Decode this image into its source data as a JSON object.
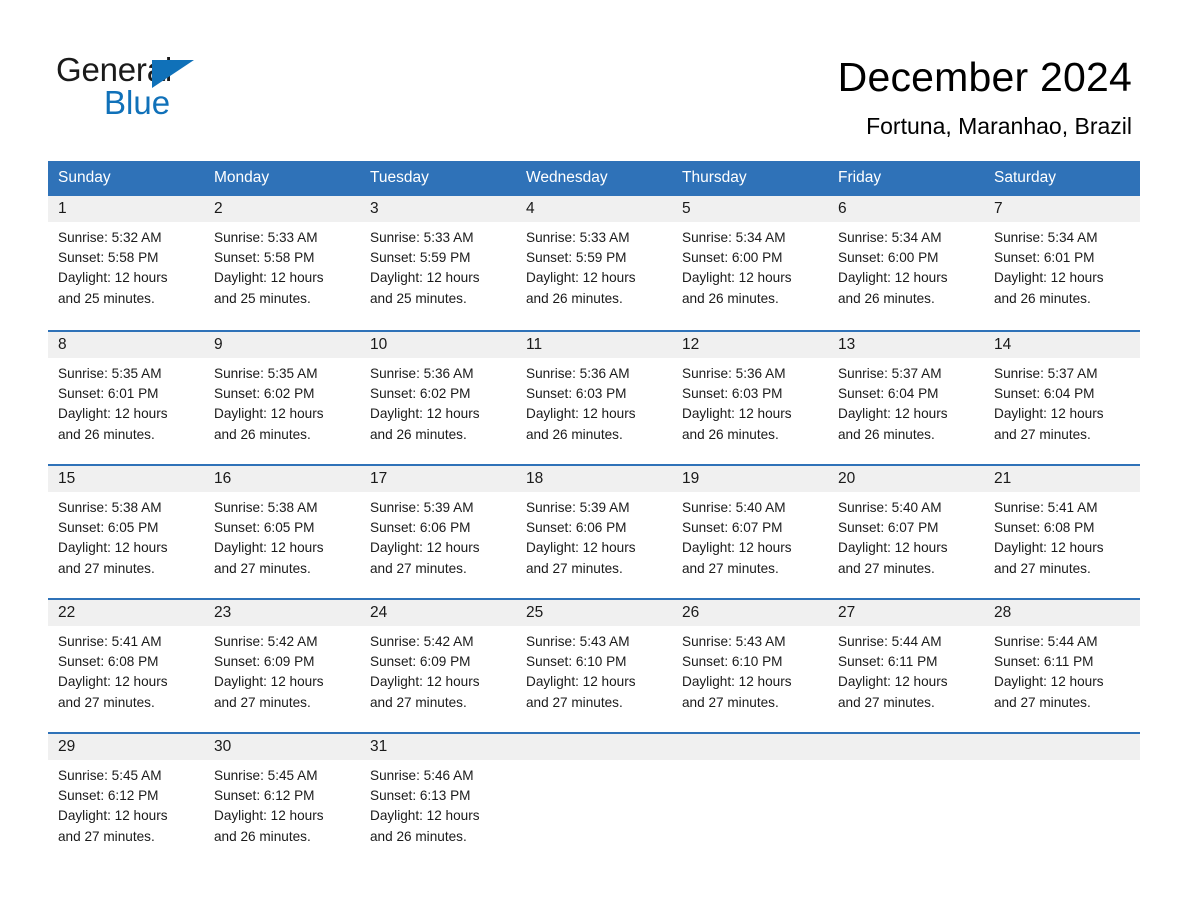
{
  "brand": {
    "name_part1": "General",
    "name_part2": "Blue",
    "triangle_color": "#1071b9"
  },
  "header": {
    "title": "December 2024",
    "subtitle": "Fortuna, Maranhao, Brazil",
    "header_bg_color": "#2f72b8",
    "daynum_band_color": "#f0f0f0"
  },
  "weekday_headers": [
    "Sunday",
    "Monday",
    "Tuesday",
    "Wednesday",
    "Thursday",
    "Friday",
    "Saturday"
  ],
  "weeks": [
    [
      {
        "day": "1",
        "sunrise": "Sunrise: 5:32 AM",
        "sunset": "Sunset: 5:58 PM",
        "daylight": "Daylight: 12 hours and 25 minutes."
      },
      {
        "day": "2",
        "sunrise": "Sunrise: 5:33 AM",
        "sunset": "Sunset: 5:58 PM",
        "daylight": "Daylight: 12 hours and 25 minutes."
      },
      {
        "day": "3",
        "sunrise": "Sunrise: 5:33 AM",
        "sunset": "Sunset: 5:59 PM",
        "daylight": "Daylight: 12 hours and 25 minutes."
      },
      {
        "day": "4",
        "sunrise": "Sunrise: 5:33 AM",
        "sunset": "Sunset: 5:59 PM",
        "daylight": "Daylight: 12 hours and 26 minutes."
      },
      {
        "day": "5",
        "sunrise": "Sunrise: 5:34 AM",
        "sunset": "Sunset: 6:00 PM",
        "daylight": "Daylight: 12 hours and 26 minutes."
      },
      {
        "day": "6",
        "sunrise": "Sunrise: 5:34 AM",
        "sunset": "Sunset: 6:00 PM",
        "daylight": "Daylight: 12 hours and 26 minutes."
      },
      {
        "day": "7",
        "sunrise": "Sunrise: 5:34 AM",
        "sunset": "Sunset: 6:01 PM",
        "daylight": "Daylight: 12 hours and 26 minutes."
      }
    ],
    [
      {
        "day": "8",
        "sunrise": "Sunrise: 5:35 AM",
        "sunset": "Sunset: 6:01 PM",
        "daylight": "Daylight: 12 hours and 26 minutes."
      },
      {
        "day": "9",
        "sunrise": "Sunrise: 5:35 AM",
        "sunset": "Sunset: 6:02 PM",
        "daylight": "Daylight: 12 hours and 26 minutes."
      },
      {
        "day": "10",
        "sunrise": "Sunrise: 5:36 AM",
        "sunset": "Sunset: 6:02 PM",
        "daylight": "Daylight: 12 hours and 26 minutes."
      },
      {
        "day": "11",
        "sunrise": "Sunrise: 5:36 AM",
        "sunset": "Sunset: 6:03 PM",
        "daylight": "Daylight: 12 hours and 26 minutes."
      },
      {
        "day": "12",
        "sunrise": "Sunrise: 5:36 AM",
        "sunset": "Sunset: 6:03 PM",
        "daylight": "Daylight: 12 hours and 26 minutes."
      },
      {
        "day": "13",
        "sunrise": "Sunrise: 5:37 AM",
        "sunset": "Sunset: 6:04 PM",
        "daylight": "Daylight: 12 hours and 26 minutes."
      },
      {
        "day": "14",
        "sunrise": "Sunrise: 5:37 AM",
        "sunset": "Sunset: 6:04 PM",
        "daylight": "Daylight: 12 hours and 27 minutes."
      }
    ],
    [
      {
        "day": "15",
        "sunrise": "Sunrise: 5:38 AM",
        "sunset": "Sunset: 6:05 PM",
        "daylight": "Daylight: 12 hours and 27 minutes."
      },
      {
        "day": "16",
        "sunrise": "Sunrise: 5:38 AM",
        "sunset": "Sunset: 6:05 PM",
        "daylight": "Daylight: 12 hours and 27 minutes."
      },
      {
        "day": "17",
        "sunrise": "Sunrise: 5:39 AM",
        "sunset": "Sunset: 6:06 PM",
        "daylight": "Daylight: 12 hours and 27 minutes."
      },
      {
        "day": "18",
        "sunrise": "Sunrise: 5:39 AM",
        "sunset": "Sunset: 6:06 PM",
        "daylight": "Daylight: 12 hours and 27 minutes."
      },
      {
        "day": "19",
        "sunrise": "Sunrise: 5:40 AM",
        "sunset": "Sunset: 6:07 PM",
        "daylight": "Daylight: 12 hours and 27 minutes."
      },
      {
        "day": "20",
        "sunrise": "Sunrise: 5:40 AM",
        "sunset": "Sunset: 6:07 PM",
        "daylight": "Daylight: 12 hours and 27 minutes."
      },
      {
        "day": "21",
        "sunrise": "Sunrise: 5:41 AM",
        "sunset": "Sunset: 6:08 PM",
        "daylight": "Daylight: 12 hours and 27 minutes."
      }
    ],
    [
      {
        "day": "22",
        "sunrise": "Sunrise: 5:41 AM",
        "sunset": "Sunset: 6:08 PM",
        "daylight": "Daylight: 12 hours and 27 minutes."
      },
      {
        "day": "23",
        "sunrise": "Sunrise: 5:42 AM",
        "sunset": "Sunset: 6:09 PM",
        "daylight": "Daylight: 12 hours and 27 minutes."
      },
      {
        "day": "24",
        "sunrise": "Sunrise: 5:42 AM",
        "sunset": "Sunset: 6:09 PM",
        "daylight": "Daylight: 12 hours and 27 minutes."
      },
      {
        "day": "25",
        "sunrise": "Sunrise: 5:43 AM",
        "sunset": "Sunset: 6:10 PM",
        "daylight": "Daylight: 12 hours and 27 minutes."
      },
      {
        "day": "26",
        "sunrise": "Sunrise: 5:43 AM",
        "sunset": "Sunset: 6:10 PM",
        "daylight": "Daylight: 12 hours and 27 minutes."
      },
      {
        "day": "27",
        "sunrise": "Sunrise: 5:44 AM",
        "sunset": "Sunset: 6:11 PM",
        "daylight": "Daylight: 12 hours and 27 minutes."
      },
      {
        "day": "28",
        "sunrise": "Sunrise: 5:44 AM",
        "sunset": "Sunset: 6:11 PM",
        "daylight": "Daylight: 12 hours and 27 minutes."
      }
    ],
    [
      {
        "day": "29",
        "sunrise": "Sunrise: 5:45 AM",
        "sunset": "Sunset: 6:12 PM",
        "daylight": "Daylight: 12 hours and 27 minutes."
      },
      {
        "day": "30",
        "sunrise": "Sunrise: 5:45 AM",
        "sunset": "Sunset: 6:12 PM",
        "daylight": "Daylight: 12 hours and 26 minutes."
      },
      {
        "day": "31",
        "sunrise": "Sunrise: 5:46 AM",
        "sunset": "Sunset: 6:13 PM",
        "daylight": "Daylight: 12 hours and 26 minutes."
      },
      {
        "day": "",
        "sunrise": "",
        "sunset": "",
        "daylight": ""
      },
      {
        "day": "",
        "sunrise": "",
        "sunset": "",
        "daylight": ""
      },
      {
        "day": "",
        "sunrise": "",
        "sunset": "",
        "daylight": ""
      },
      {
        "day": "",
        "sunrise": "",
        "sunset": "",
        "daylight": ""
      }
    ]
  ]
}
